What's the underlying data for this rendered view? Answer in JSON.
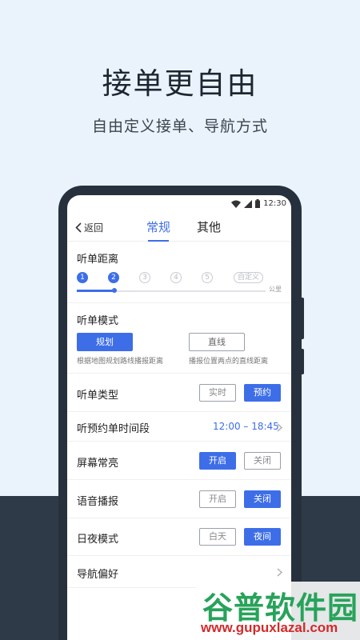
{
  "promo": {
    "headline": "接单更自由",
    "subline": "自由定义接单、导航方式"
  },
  "statusbar": {
    "time": "12:30",
    "icons": [
      "wifi-icon",
      "signal-icon",
      "battery-icon"
    ]
  },
  "navbar": {
    "back_label": "返回",
    "tabs": [
      {
        "label": "常规",
        "active": true
      },
      {
        "label": "其他",
        "active": false
      }
    ]
  },
  "distance": {
    "title": "听单距离",
    "steps": [
      "1",
      "2",
      "3",
      "4",
      "5"
    ],
    "custom_label": "自定义",
    "selected": "2",
    "unit": "公里"
  },
  "mode": {
    "title": "听单模式",
    "options": [
      {
        "label": "规划",
        "desc": "根据地图规划路线播报距离",
        "active": true
      },
      {
        "label": "直线",
        "desc": "播报位置两点的直线距离",
        "active": false
      }
    ]
  },
  "order_type": {
    "label": "听单类型",
    "options": [
      {
        "label": "实时",
        "active": false
      },
      {
        "label": "预约",
        "active": true
      }
    ]
  },
  "reserve_time": {
    "label": "听预约单时间段",
    "value": "12:00 – 18:45"
  },
  "screen_on": {
    "label": "屏幕常亮",
    "options": [
      {
        "label": "开启",
        "active": true
      },
      {
        "label": "关闭",
        "active": false
      }
    ]
  },
  "voice": {
    "label": "语音播报",
    "options": [
      {
        "label": "开启",
        "active": false
      },
      {
        "label": "关闭",
        "active": true
      }
    ]
  },
  "day_night": {
    "label": "日夜模式",
    "options": [
      {
        "label": "白天",
        "active": false
      },
      {
        "label": "夜间",
        "active": true
      }
    ]
  },
  "nav_pref": {
    "label": "导航偏好"
  },
  "colors": {
    "accent": "#3d6ee8",
    "dark_bg": "#2f3a48",
    "light_bg": "#eaf3fc"
  },
  "watermark": {
    "main": "谷普软件园",
    "url": "www.gupuxlazal.com"
  }
}
